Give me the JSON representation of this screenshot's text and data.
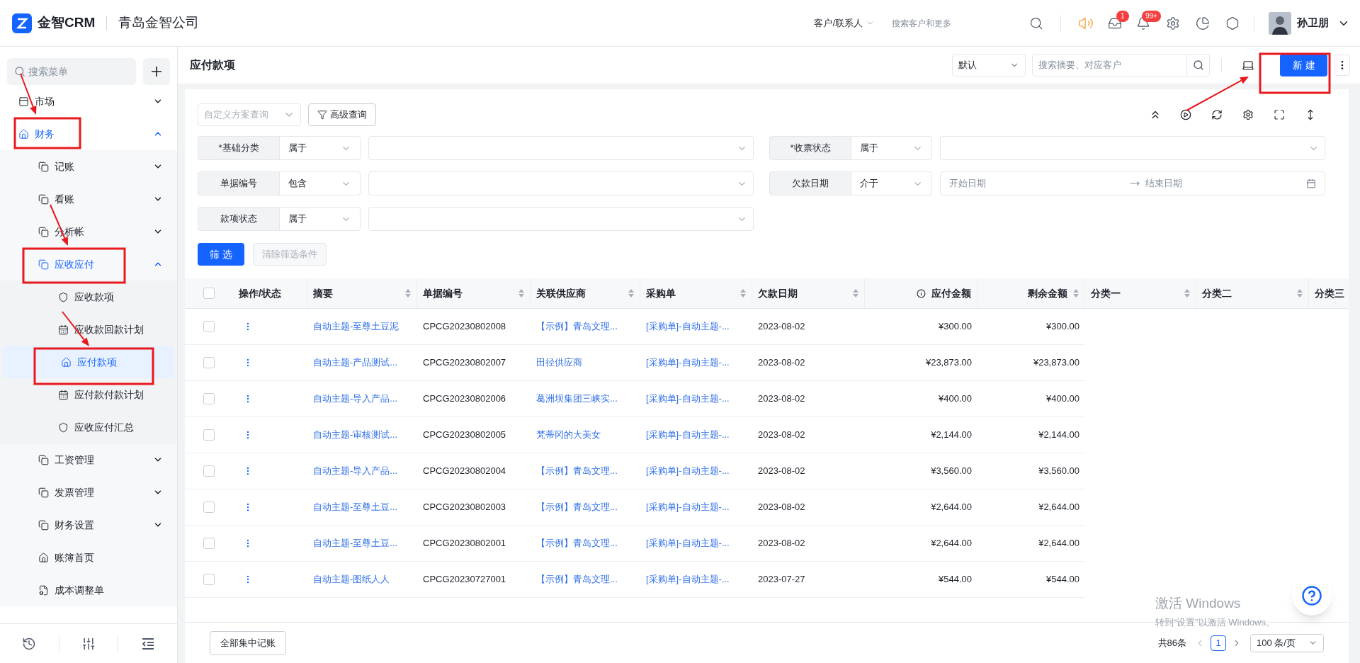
{
  "header": {
    "logo_text": "金智CRM",
    "company": "青岛金智公司",
    "search_scope": "客户/联系人",
    "search_placeholder": "搜索客户和更多",
    "message_badge": "1",
    "bell_badge": "99+",
    "user": "孙卫朋"
  },
  "sidebar": {
    "search_placeholder": "搜索菜单",
    "items": [
      {
        "label": "市场",
        "kind": "market",
        "expanded": false,
        "selected": false
      },
      {
        "label": "财务",
        "kind": "home",
        "expanded": true,
        "selected": false,
        "children": [
          {
            "label": "记账",
            "kind": "module",
            "expanded": false,
            "selected": false
          },
          {
            "label": "看账",
            "kind": "module",
            "expanded": false,
            "selected": false
          },
          {
            "label": "分析帐",
            "kind": "module",
            "expanded": false,
            "selected": false
          },
          {
            "label": "应收应付",
            "kind": "module",
            "expanded": true,
            "selected": false,
            "children": [
              {
                "label": "应收款项",
                "kind": "shield",
                "selected": false
              },
              {
                "label": "应收款回款计划",
                "kind": "plan",
                "selected": false
              },
              {
                "label": "应付款项",
                "kind": "home",
                "selected": true
              },
              {
                "label": "应付款付款计划",
                "kind": "plan",
                "selected": false
              },
              {
                "label": "应收应付汇总",
                "kind": "shield",
                "selected": false
              }
            ]
          },
          {
            "label": "工资管理",
            "kind": "module",
            "expanded": false,
            "selected": false
          },
          {
            "label": "发票管理",
            "kind": "module",
            "expanded": false,
            "selected": false
          },
          {
            "label": "财务设置",
            "kind": "module",
            "expanded": false,
            "selected": false
          },
          {
            "label": "账簿首页",
            "kind": "house",
            "selected": false
          },
          {
            "label": "成本调整单",
            "kind": "file",
            "selected": false
          }
        ]
      }
    ]
  },
  "page": {
    "title": "应付款项",
    "view_select": "默认",
    "search_placeholder": "搜索摘要、对应客户",
    "new_button": "新建"
  },
  "filters": {
    "scheme_placeholder": "自定义方案查询",
    "advanced_button": "高级查询",
    "fields": [
      {
        "label": "*基础分类",
        "operator": "属于",
        "kind": "select"
      },
      {
        "label": "*收票状态",
        "operator": "属于",
        "kind": "select"
      },
      {
        "label": "单据编号",
        "operator": "包含",
        "kind": "select"
      },
      {
        "label": "欠款日期",
        "operator": "介于",
        "kind": "date_range",
        "start_placeholder": "开始日期",
        "end_placeholder": "结束日期"
      },
      {
        "label": "款项状态",
        "operator": "属于",
        "kind": "select"
      }
    ],
    "apply_button": "筛选",
    "clear_button": "清除筛选条件",
    "clear_disabled": true
  },
  "table": {
    "all_checked": false,
    "columns": [
      {
        "label": "操作/状态",
        "kind": "text",
        "sortable": false
      },
      {
        "label": "摘要",
        "kind": "text",
        "sortable": true
      },
      {
        "label": "单据编号",
        "kind": "text",
        "sortable": true
      },
      {
        "label": "关联供应商",
        "kind": "text",
        "sortable": true
      },
      {
        "label": "采购单",
        "kind": "text",
        "sortable": true
      },
      {
        "label": "欠款日期",
        "kind": "text",
        "sortable": true
      },
      {
        "label": "应付金额",
        "kind": "amount",
        "sortable": false,
        "info": true
      },
      {
        "label": "剩余金额",
        "kind": "amount",
        "sortable": true
      },
      {
        "label": "分类一",
        "kind": "text",
        "sortable": true
      },
      {
        "label": "分类二",
        "kind": "text",
        "sortable": true
      },
      {
        "label": "分类三",
        "kind": "text"
      }
    ],
    "rows": [
      {
        "checked": false,
        "summary": "自动主题-至尊土豆泥",
        "number": "CPCG20230802008",
        "supplier": "【示例】青岛文理...",
        "purchase": "[采购单]-自动主题-...",
        "date": "2023-08-02",
        "amount": "¥300.00",
        "remaining": "¥300.00"
      },
      {
        "checked": false,
        "summary": "自动主题-产品测试...",
        "number": "CPCG20230802007",
        "supplier": "田径供应商",
        "purchase": "[采购单]-自动主题-...",
        "date": "2023-08-02",
        "amount": "¥23,873.00",
        "remaining": "¥23,873.00"
      },
      {
        "checked": false,
        "summary": "自动主题-导入产品...",
        "number": "CPCG20230802006",
        "supplier": "葛洲坝集团三峡实...",
        "purchase": "[采购单]-自动主题-...",
        "date": "2023-08-02",
        "amount": "¥400.00",
        "remaining": "¥400.00"
      },
      {
        "checked": false,
        "summary": "自动主题-审核测试...",
        "number": "CPCG20230802005",
        "supplier": "梵蒂冈的大美女",
        "purchase": "[采购单]-自动主题-...",
        "date": "2023-08-02",
        "amount": "¥2,144.00",
        "remaining": "¥2,144.00"
      },
      {
        "checked": false,
        "summary": "自动主题-导入产品...",
        "number": "CPCG20230802004",
        "supplier": "【示例】青岛文理...",
        "purchase": "[采购单]-自动主题-...",
        "date": "2023-08-02",
        "amount": "¥3,560.00",
        "remaining": "¥3,560.00"
      },
      {
        "checked": false,
        "summary": "自动主题-至尊土豆...",
        "number": "CPCG20230802003",
        "supplier": "【示例】青岛文理...",
        "purchase": "[采购单]-自动主题-...",
        "date": "2023-08-02",
        "amount": "¥2,644.00",
        "remaining": "¥2,644.00"
      },
      {
        "checked": false,
        "summary": "自动主题-至尊土豆...",
        "number": "CPCG20230802001",
        "supplier": "【示例】青岛文理...",
        "purchase": "[采购单]-自动主题-...",
        "date": "2023-08-02",
        "amount": "¥2,644.00",
        "remaining": "¥2,644.00"
      },
      {
        "checked": false,
        "summary": "自动主题-图纸人人",
        "number": "CPCG20230727001",
        "supplier": "【示例】青岛文理...",
        "purchase": "[采购单]-自动主题-...",
        "date": "2023-07-27",
        "amount": "¥544.00",
        "remaining": "¥544.00"
      }
    ]
  },
  "footer": {
    "batch_button": "全部集中记账",
    "total": "共86条",
    "pages": [
      {
        "label": "1",
        "selected": true
      }
    ],
    "page_size": "100 条/页"
  },
  "watermark": {
    "title": "激活 Windows",
    "subtitle": "转到“设置”以激活 Windows。"
  }
}
